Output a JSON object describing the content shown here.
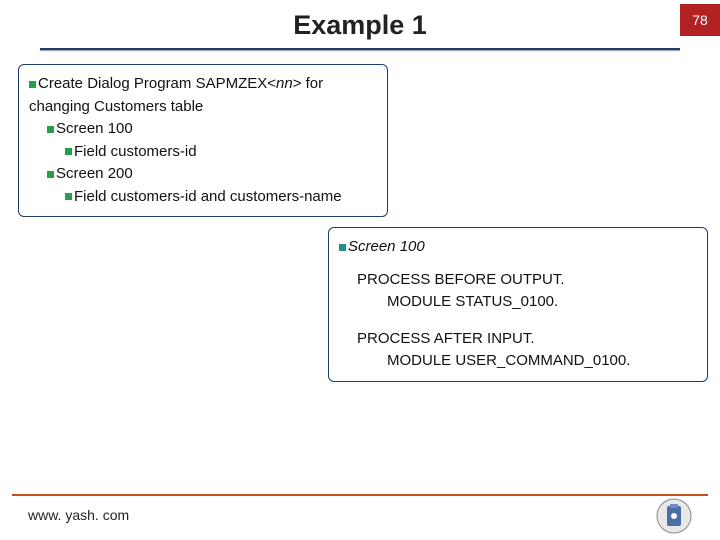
{
  "header": {
    "title": "Example 1",
    "page_number": "78"
  },
  "box1": {
    "line1_pre": "Create Dialog Program SAPMZEX<",
    "line1_em": "nn",
    "line1_post": "> for",
    "line2": "changing Customers table",
    "line3": "Screen 100",
    "line4": "Field customers-id",
    "line5": "Screen 200",
    "line6": "Field customers-id and customers-name"
  },
  "box2": {
    "heading": "Screen 100",
    "pbo_line": "PROCESS BEFORE OUTPUT.",
    "pbo_module": "MODULE STATUS_0100.",
    "pai_line": "PROCESS AFTER INPUT.",
    "pai_module": "MODULE USER_COMMAND_0100."
  },
  "footer": {
    "url": "www. yash. com"
  }
}
